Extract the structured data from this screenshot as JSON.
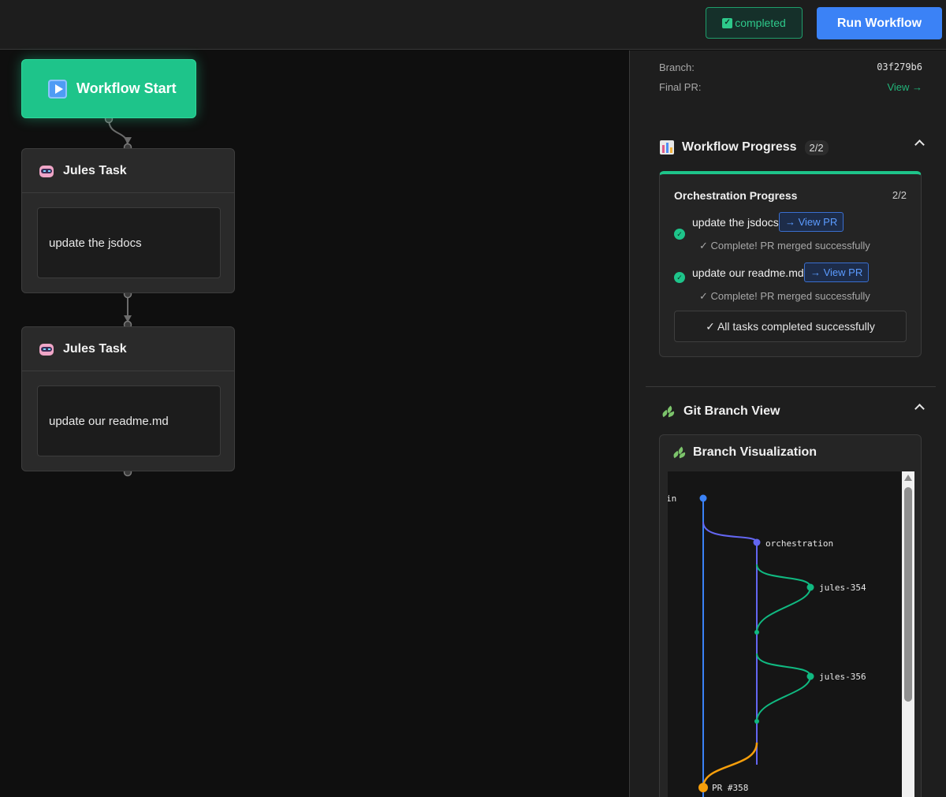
{
  "topbar": {
    "status_label": "completed",
    "run_label": "Run Workflow"
  },
  "canvas": {
    "start_label": "Workflow Start",
    "tasks": [
      {
        "title": "Jules Task",
        "prompt": "update the jsdocs"
      },
      {
        "title": "Jules Task",
        "prompt": "update our readme.md"
      }
    ]
  },
  "details": {
    "branch_label": "Branch:",
    "branch_value": "03f279b6",
    "final_pr_label": "Final PR:",
    "final_pr_link": "View →"
  },
  "progress": {
    "section_title": "Workflow Progress",
    "section_count": "2/2",
    "card_title": "Orchestration Progress",
    "card_count": "2/2",
    "tasks": [
      {
        "label": "update the jsdocs",
        "view_pr": "→ View PR",
        "status": "✓ Complete! PR merged successfully"
      },
      {
        "label": "update our readme.md",
        "view_pr": "→ View PR",
        "status": "✓ Complete! PR merged successfully"
      }
    ],
    "summary": "✓ All tasks completed successfully"
  },
  "git": {
    "section_title": "Git Branch View",
    "card_title": "Branch Visualization",
    "branches": {
      "main": "in",
      "orchestration": "orchestration",
      "task1": "jules-354",
      "task2": "jules-356",
      "pr": "PR #358"
    },
    "colors": {
      "main": "#3b82f6",
      "orchestration": "#6366f1",
      "task": "#10b981",
      "pr": "#f59e0b"
    }
  },
  "colors": {
    "accent_green": "#1ec48a",
    "accent_blue": "#3b82f6"
  }
}
